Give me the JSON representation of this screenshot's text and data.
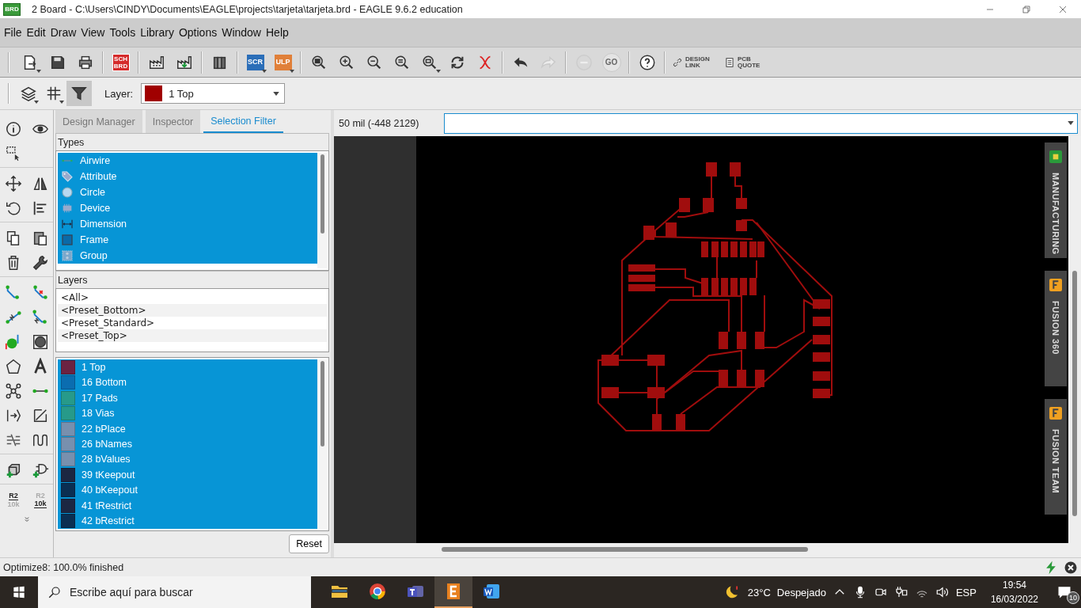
{
  "window": {
    "title": "2 Board - C:\\Users\\CINDY\\Documents\\EAGLE\\projects\\tarjeta\\tarjeta.brd - EAGLE 9.6.2 education",
    "badge": "BRD"
  },
  "menu": [
    "File",
    "Edit",
    "Draw",
    "View",
    "Tools",
    "Library",
    "Options",
    "Window",
    "Help"
  ],
  "toolbar": [
    {
      "kind": "new",
      "disabled": false
    },
    {
      "kind": "save",
      "disabled": false
    },
    {
      "kind": "print",
      "disabled": false
    },
    {
      "kind": "separator"
    },
    {
      "kind": "sch_brd",
      "text": "SCH BRD",
      "disabled": false
    },
    {
      "kind": "separator"
    },
    {
      "kind": "cam",
      "disabled": false
    },
    {
      "kind": "export",
      "disabled": false
    },
    {
      "kind": "separator"
    },
    {
      "kind": "library",
      "disabled": false
    },
    {
      "kind": "separator"
    },
    {
      "kind": "scr",
      "text": "SCR",
      "disabled": false
    },
    {
      "kind": "ulp",
      "text": "ULP",
      "disabled": false
    },
    {
      "kind": "separator"
    },
    {
      "kind": "zoom_fit",
      "disabled": false
    },
    {
      "kind": "zoom_in",
      "disabled": false
    },
    {
      "kind": "zoom_out",
      "disabled": false
    },
    {
      "kind": "zoom_select",
      "disabled": false
    },
    {
      "kind": "zoom_area",
      "disabled": false
    },
    {
      "kind": "redraw",
      "disabled": false
    },
    {
      "kind": "ratsnest",
      "disabled": false
    },
    {
      "kind": "separator"
    },
    {
      "kind": "undo",
      "disabled": false
    },
    {
      "kind": "redo",
      "disabled": true
    },
    {
      "kind": "separator"
    },
    {
      "kind": "stop",
      "disabled": true
    },
    {
      "kind": "go",
      "text": "GO",
      "disabled": true
    },
    {
      "kind": "separator"
    },
    {
      "kind": "help",
      "disabled": false
    },
    {
      "kind": "separator"
    },
    {
      "kind": "design_link",
      "text": "DESIGN LINK",
      "disabled": false
    },
    {
      "kind": "pcb_quote",
      "text": "PCB QUOTE",
      "disabled": false
    }
  ],
  "view_tools": [
    {
      "kind": "layers",
      "selected": false
    },
    {
      "kind": "grid",
      "selected": false
    },
    {
      "kind": "filter",
      "selected": true
    }
  ],
  "layer_label": "Layer:",
  "layer_select": {
    "color": "#a00000",
    "value": "1 Top"
  },
  "palette": [
    {
      "kind": "info"
    },
    {
      "kind": "show"
    },
    {
      "kind": "select"
    },
    {
      "kind": "blank"
    },
    {
      "kind": "separator"
    },
    {
      "kind": "move"
    },
    {
      "kind": "mirror"
    },
    {
      "kind": "rotate"
    },
    {
      "kind": "align"
    },
    {
      "kind": "separator"
    },
    {
      "kind": "copy"
    },
    {
      "kind": "paste"
    },
    {
      "kind": "delete"
    },
    {
      "kind": "wrench"
    },
    {
      "kind": "separator"
    },
    {
      "kind": "route"
    },
    {
      "kind": "ripup"
    },
    {
      "kind": "split"
    },
    {
      "kind": "route_multi"
    },
    {
      "kind": "via"
    },
    {
      "kind": "hole"
    },
    {
      "kind": "polygon"
    },
    {
      "kind": "text"
    },
    {
      "kind": "signal"
    },
    {
      "kind": "wire"
    },
    {
      "kind": "pin"
    },
    {
      "kind": "line"
    },
    {
      "kind": "meander"
    },
    {
      "kind": "wave"
    },
    {
      "kind": "separator"
    },
    {
      "kind": "add"
    },
    {
      "kind": "add_gate"
    },
    {
      "kind": "separator"
    },
    {
      "kind": "value_button",
      "top": "R2",
      "bottom": "10k",
      "top_emphasized": true
    },
    {
      "kind": "value_button",
      "top": "R2",
      "bottom": "10k",
      "top_emphasized": false
    },
    {
      "kind": "more"
    }
  ],
  "panel": {
    "tabs": [
      {
        "label": "Design Manager",
        "selected": false
      },
      {
        "label": "Inspector",
        "selected": false
      },
      {
        "label": "Selection Filter",
        "selected": true
      }
    ],
    "types_header": "Types",
    "types": [
      {
        "label": "Airwire",
        "kind": "airwire",
        "selected": true
      },
      {
        "label": "Attribute",
        "kind": "attribute",
        "selected": true
      },
      {
        "label": "Circle",
        "kind": "circle",
        "selected": true
      },
      {
        "label": "Device",
        "kind": "device",
        "selected": true
      },
      {
        "label": "Dimension",
        "kind": "dimension",
        "selected": true
      },
      {
        "label": "Frame",
        "kind": "frame",
        "selected": true
      },
      {
        "label": "Group",
        "kind": "group",
        "selected": true
      }
    ],
    "layers_header": "Layers",
    "presets": [
      {
        "label": "<All>"
      },
      {
        "label": "<Preset_Bottom>"
      },
      {
        "label": "<Preset_Standard>"
      },
      {
        "label": "<Preset_Top>"
      }
    ],
    "layers": [
      {
        "label": "1 Top",
        "color": "#6b2342",
        "selected": true
      },
      {
        "label": "16 Bottom",
        "color": "#0b6db0",
        "selected": true
      },
      {
        "label": "17 Pads",
        "color": "#279a8a",
        "selected": true
      },
      {
        "label": "18 Vias",
        "color": "#279a8a",
        "selected": true
      },
      {
        "label": "22 bPlace",
        "color": "#7890ae",
        "selected": true
      },
      {
        "label": "26 bNames",
        "color": "#7890ae",
        "selected": true
      },
      {
        "label": "28 bValues",
        "color": "#7890ae",
        "selected": true
      },
      {
        "label": "39 tKeepout",
        "color": "#1c2742",
        "selected": true
      },
      {
        "label": "40 bKeepout",
        "color": "#0b2f52",
        "selected": true
      },
      {
        "label": "41 tRestrict",
        "color": "#1c2742",
        "selected": true
      },
      {
        "label": "42 bRestrict",
        "color": "#0b2f52",
        "selected": true
      }
    ],
    "reset": "Reset"
  },
  "workspace": {
    "coordinates": "50 mil (-448 2129)",
    "side_tabs": [
      {
        "label": "MANUFACTURING",
        "kind": "manufacturing"
      },
      {
        "label": "FUSION 360",
        "kind": "fusion"
      },
      {
        "label": "FUSION TEAM",
        "kind": "fusion"
      }
    ]
  },
  "status_bar": {
    "text": "Optimize8: 100.0% finished"
  },
  "taskbar": {
    "search": {
      "placeholder": "Escribe aquí para buscar"
    },
    "apps": [
      {
        "kind": "explorer",
        "selected": false
      },
      {
        "kind": "chrome",
        "selected": false
      },
      {
        "kind": "teams",
        "selected": false
      },
      {
        "kind": "eagle",
        "selected": true
      },
      {
        "kind": "word",
        "selected": false
      }
    ],
    "temperature": "23°C",
    "weather": "Despejado",
    "language": "ESP",
    "time": "19:54",
    "date": "16/03/2022",
    "notifications": "10"
  }
}
